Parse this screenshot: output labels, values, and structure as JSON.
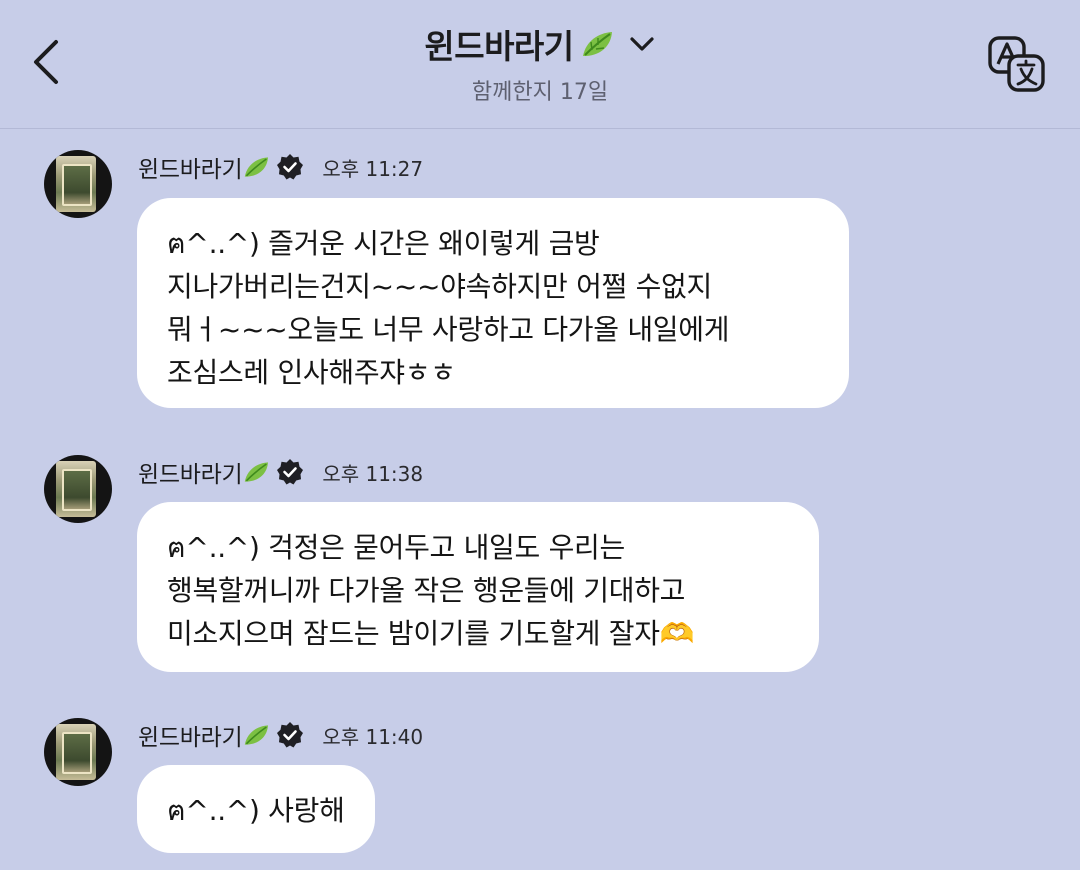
{
  "header": {
    "title": "윈드바라기",
    "subtitle": "함께한지 17일",
    "back_icon": "chevron-left-icon",
    "dropdown_icon": "chevron-down-icon",
    "translate_icon": "translate-icon",
    "title_emoji": "leaf-emoji"
  },
  "messages": [
    {
      "sender": "윈드바라기",
      "time": "오후 11:27",
      "text": "ฅ^..^) 즐거운 시간은 왜이렇게 금방\n지나가버리는건지~~~야속하지만 어쩔 수없지\n뭐ㅓ~~~오늘도 너무 사랑하고 다가올 내일에게\n조심스레 인사해주쟈ㅎㅎ"
    },
    {
      "sender": "윈드바라기",
      "time": "오후 11:38",
      "text": "ฅ^..^) 걱정은 묻어두고 내일도 우리는\n행복할꺼니까 다가올 작은 행운들에 기대하고\n미소지으며 잠드는 밤이기를 기도할게 잘자🫶"
    },
    {
      "sender": "윈드바라기",
      "time": "오후 11:40",
      "text": "ฅ^..^) 사랑해"
    }
  ],
  "colors": {
    "background": "#c7cde8",
    "bubble": "#ffffff",
    "text": "#1c1c1e",
    "subtitle": "#5e6070"
  }
}
